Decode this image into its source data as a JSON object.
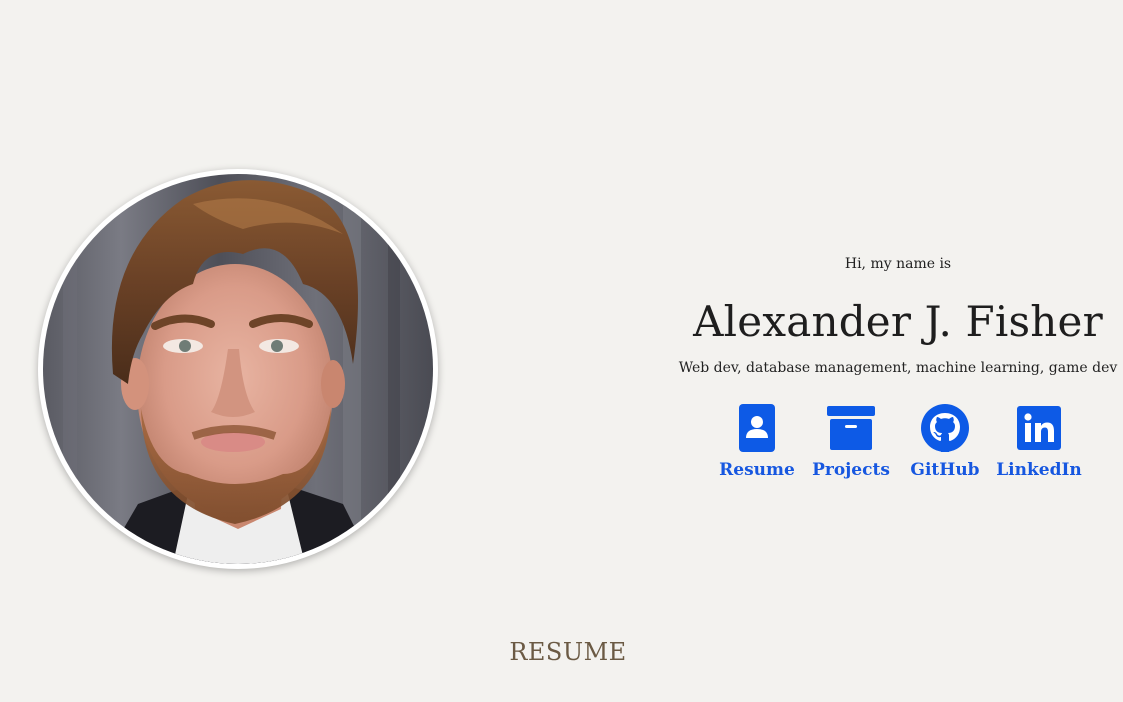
{
  "hero": {
    "greeting": "Hi, my name is",
    "name": "Alexander J. Fisher",
    "tagline": "Web dev, database management, machine learning, game dev"
  },
  "links": [
    {
      "label": "Resume",
      "icon": "contact-card-icon"
    },
    {
      "label": "Projects",
      "icon": "archive-box-icon"
    },
    {
      "label": "GitHub",
      "icon": "github-icon"
    },
    {
      "label": "LinkedIn",
      "icon": "linkedin-icon"
    }
  ],
  "section": {
    "title": "RESUME"
  },
  "colors": {
    "background": "#f3f2ef",
    "link": "#0d5ae6",
    "section_title": "#6b5a44"
  }
}
